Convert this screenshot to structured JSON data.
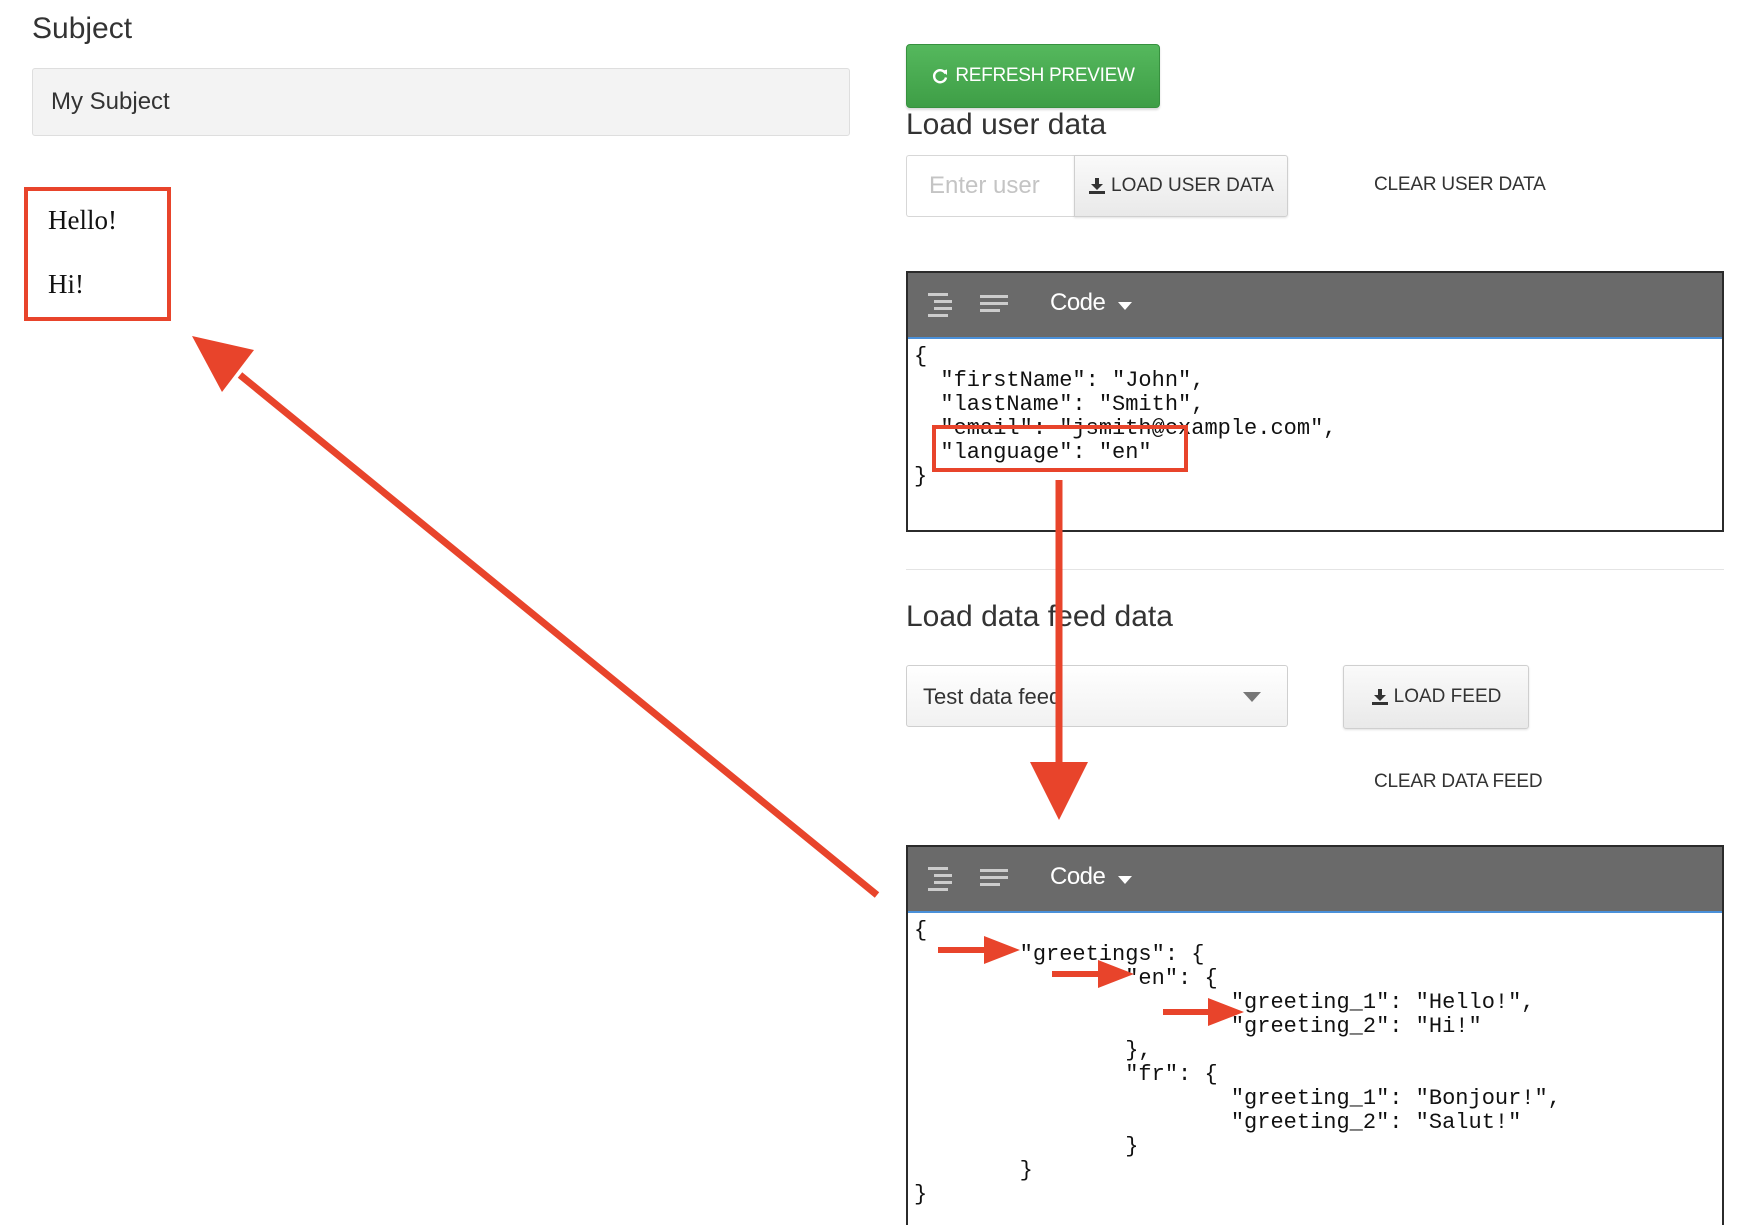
{
  "subject": {
    "label": "Subject",
    "value": "My Subject"
  },
  "preview": {
    "line1": "Hello!",
    "line2": "Hi!"
  },
  "toolbar": {
    "refresh_label": "REFRESH PREVIEW"
  },
  "user_data": {
    "heading": "Load user data",
    "input_placeholder": "Enter user",
    "load_label": "LOAD USER DATA",
    "clear_label": "CLEAR USER DATA"
  },
  "user_editor": {
    "mode_label": "Code",
    "code": "{\n  \"firstName\": \"John\",\n  \"lastName\": \"Smith\",\n  \"email\": \"jsmith@example.com\",\n  \"language\": \"en\"\n}"
  },
  "feed_data": {
    "heading": "Load data feed data",
    "select_value": "Test data feed",
    "load_label": "LOAD FEED",
    "clear_label": "CLEAR DATA FEED"
  },
  "feed_editor": {
    "mode_label": "Code",
    "code": "{\n        \"greetings\": {\n                \"en\": {\n                        \"greeting_1\": \"Hello!\",\n                        \"greeting_2\": \"Hi!\"\n                },\n                \"fr\": {\n                        \"greeting_1\": \"Bonjour!\",\n                        \"greeting_2\": \"Salut!\"\n                }\n        }\n}"
  },
  "colors": {
    "accent_green": "#4cae54",
    "annotation_red": "#e8442b",
    "toolbar_gray": "#6a6a6a"
  }
}
